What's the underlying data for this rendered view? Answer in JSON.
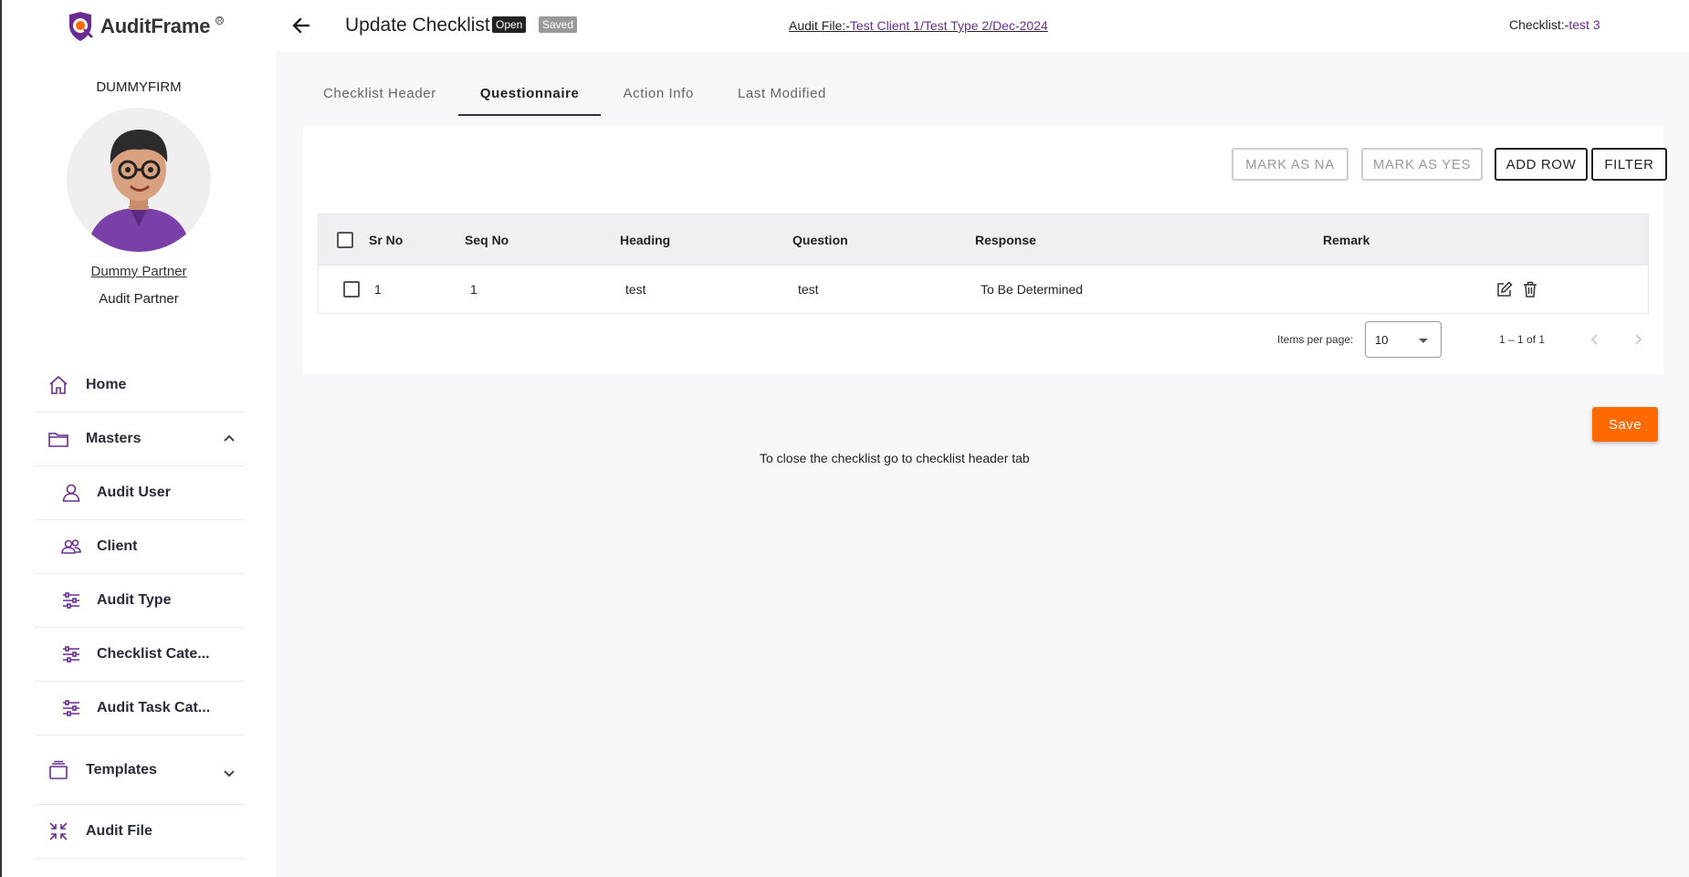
{
  "app": {
    "name": "AuditFrame"
  },
  "sidebar": {
    "firm": "DUMMYFIRM",
    "user_name": "Dummy Partner",
    "user_role": "Audit Partner",
    "items": [
      {
        "label": "Home",
        "icon": "home-icon"
      },
      {
        "label": "Masters",
        "icon": "folder-icon"
      },
      {
        "label": "Audit User",
        "icon": "user-icon"
      },
      {
        "label": "Client",
        "icon": "users-icon"
      },
      {
        "label": "Audit Type",
        "icon": "sliders-icon"
      },
      {
        "label": "Checklist Cate...",
        "icon": "sliders-icon"
      },
      {
        "label": "Audit Task Cat...",
        "icon": "sliders-icon"
      },
      {
        "label": "Templates",
        "icon": "layers-icon"
      },
      {
        "label": "Audit File",
        "icon": "compress-icon"
      }
    ]
  },
  "header": {
    "title": "Update Checklist",
    "status_open": "Open",
    "status_saved": "Saved",
    "audit_file_label": "Audit File:-",
    "audit_file_value": "Test Client 1/Test Type 2/Dec-2024",
    "checklist_label": "Checklist:-",
    "checklist_value": "test 3"
  },
  "tabs": [
    "Checklist Header",
    "Questionnaire",
    "Action Info",
    "Last Modified"
  ],
  "actions": {
    "mark_na": "MARK AS NA",
    "mark_yes": "MARK AS YES",
    "add_row": "ADD ROW",
    "filter": "FILTER"
  },
  "table": {
    "columns": [
      "Sr No",
      "Seq No",
      "Heading",
      "Question",
      "Response",
      "Remark"
    ],
    "rows": [
      {
        "sr_no": "1",
        "seq_no": "1",
        "heading": "test",
        "question": "test",
        "response": "To Be Determined",
        "remark": ""
      }
    ]
  },
  "paginator": {
    "items_per_page_label": "Items per page:",
    "items_per_page": "10",
    "range": "1 – 1 of 1"
  },
  "footer": {
    "save": "Save",
    "note": "To close the checklist go to checklist header tab"
  },
  "colors": {
    "accent": "#6a2c91",
    "save": "#ff6a00"
  }
}
